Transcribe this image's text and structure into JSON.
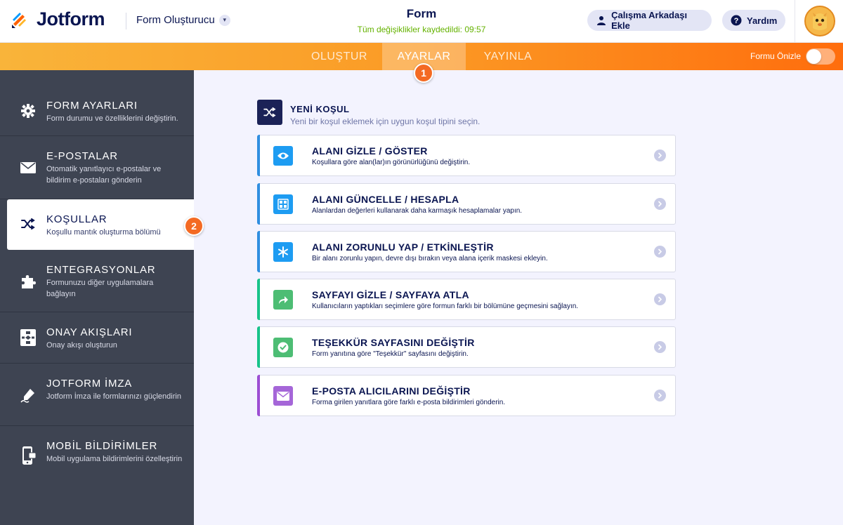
{
  "header": {
    "logo_text": "Jotform",
    "builder_label": "Form Oluşturucu",
    "form_title": "Form",
    "saved_status": "Tüm değişiklikler kaydedildi: 09:57",
    "collab_button": "Çalışma Arkadaşı Ekle",
    "help_button": "Yardım"
  },
  "nav": {
    "tabs": [
      {
        "label": "OLUŞTUR",
        "active": false
      },
      {
        "label": "AYARLAR",
        "active": true
      },
      {
        "label": "YAYINLA",
        "active": false
      }
    ],
    "preview_label": "Formu Önizle",
    "preview_on": false
  },
  "steps": [
    "1",
    "2"
  ],
  "sidebar": {
    "items": [
      {
        "title": "FORM AYARLARI",
        "desc": "Form durumu ve özelliklerini değiştirin.",
        "icon": "gear-icon"
      },
      {
        "title": "E-POSTALAR",
        "desc": "Otomatik yanıtlayıcı e-postalar ve bildirim e-postaları gönderin",
        "icon": "envelope-icon"
      },
      {
        "title": "KOŞULLAR",
        "desc": "Koşullu mantık oluşturma bölümü",
        "icon": "shuffle-icon",
        "active": true
      },
      {
        "title": "ENTEGRASYONLAR",
        "desc": "Formunuzu diğer uygulamalara bağlayın",
        "icon": "puzzle-icon"
      },
      {
        "title": "ONAY AKIŞLARI",
        "desc": "Onay akışı oluşturun",
        "icon": "flow-icon"
      },
      {
        "title": "JOTFORM İMZA",
        "desc": "Jotform İmza ile formlarınızı güçlendirin",
        "icon": "pen-icon"
      },
      {
        "title": "MOBİL BİLDİRİMLER",
        "desc": "Mobil uygulama bildirimlerini özelleştirin",
        "icon": "mobile-icon"
      }
    ]
  },
  "main": {
    "new_condition": {
      "title": "YENİ KOŞUL",
      "desc": "Yeni bir koşul eklemek için uygun koşul tipini seçin."
    },
    "conditions": [
      {
        "title": "ALANI GİZLE / GÖSTER",
        "desc": "Koşullara göre alan(lar)ın görünürlüğünü değiştirin.",
        "color": "#2f8ee0",
        "icon_bg": "#1d9cf2",
        "icon": "eye-icon"
      },
      {
        "title": "ALANI GÜNCELLE / HESAPLA",
        "desc": "Alanlardan değerleri kullanarak daha karmaşık hesaplamalar yapın.",
        "color": "#2f8ee0",
        "icon_bg": "#1d9cf2",
        "icon": "calculator-icon"
      },
      {
        "title": "ALANI ZORUNLU YAP / ETKİNLEŞTİR",
        "desc": "Bir alanı zorunlu yapın, devre dışı bırakın veya alana içerik maskesi ekleyin.",
        "color": "#2f8ee0",
        "icon_bg": "#1d9cf2",
        "icon": "asterisk-icon"
      },
      {
        "title": "SAYFAYI GİZLE / SAYFAYA ATLA",
        "desc": "Kullanıcıların yaptıkları seçimlere göre formun farklı bir bölümüne geçmesini sağlayın.",
        "color": "#18c38a",
        "icon_bg": "#4dbd74",
        "icon": "skip-arrow-icon"
      },
      {
        "title": "TEŞEKKÜR SAYFASINI DEĞİŞTİR",
        "desc": "Form yanıtına göre \"Teşekkür\" sayfasını değiştirin.",
        "color": "#18c38a",
        "icon_bg": "#4dbd74",
        "icon": "check-circle-icon"
      },
      {
        "title": "E-POSTA ALICILARINI DEĞİŞTİR",
        "desc": "Forma girilen yanıtlara göre farklı e-posta bildirimleri gönderin.",
        "color": "#9c4dd3",
        "icon_bg": "#a566d8",
        "icon": "envelope-icon"
      }
    ]
  }
}
